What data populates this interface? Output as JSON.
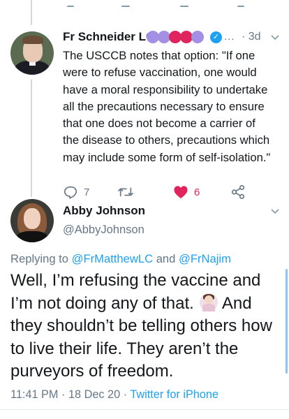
{
  "parent_tweet": {
    "author": "Fr Schneider LC",
    "badges": [
      "#a390e4",
      "#a390e4",
      "#e0245e",
      "#e0245e",
      "#a390e4"
    ],
    "ellipsis": "...",
    "time": "· 3d",
    "text": "The USCCB notes that option: \"If one\nwere to refuse vaccination, one would\nhave a moral responsibility to undertake\nall the precautions necessary to ensure\nthat one does not become a carrier of\nthe disease to others, precautions which\nmay include some form of self-isolation.\"",
    "reply_count": "7",
    "like_count": "6"
  },
  "main_tweet": {
    "author": "Abby Johnson",
    "handle": "@AbbyJohnson",
    "replying_prefix": "Replying to ",
    "replying_to_1": "@FrMatthewLC",
    "replying_and": " and ",
    "replying_to_2": "@FrNajim",
    "text_part1": "Well, I’m refusing the vaccine and I’m not doing any of that. ",
    "emoji": "person-shrugging-emoji",
    "text_part2": " And they shouldn’t be telling others how to live their life. They aren’t the purveyors of freedom.",
    "timestamp": "11:41 PM · 18 Dec 20 · ",
    "source": "Twitter for iPhone"
  },
  "colors": {
    "accent": "#1da1f2",
    "muted": "#657786",
    "like": "#e0245e"
  }
}
